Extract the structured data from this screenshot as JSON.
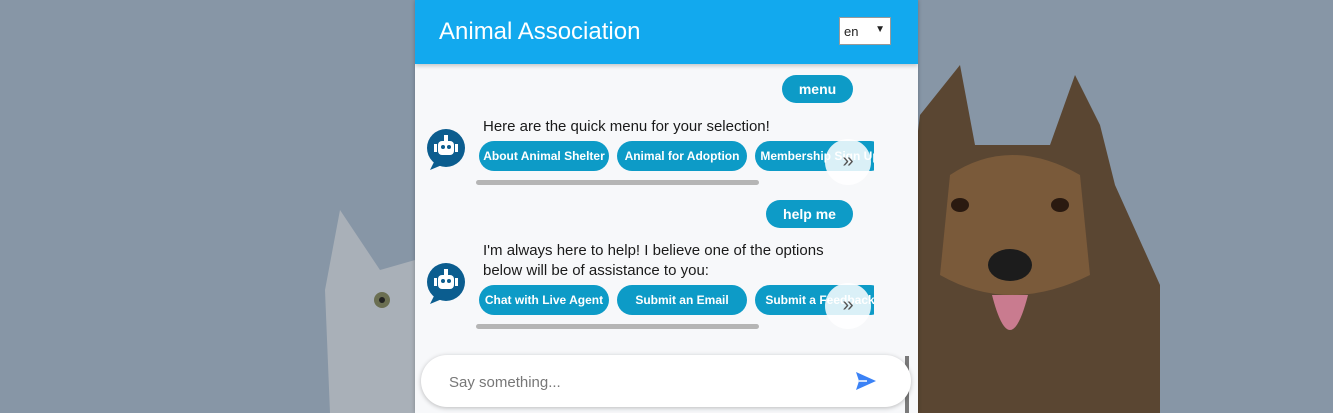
{
  "header": {
    "title": "Animal Association",
    "language": "en"
  },
  "conversation": [
    {
      "user_message": "menu",
      "bot_text": [
        "Here are the quick menu for your selection!"
      ],
      "options": [
        "About Animal Shelter",
        "Animal for Adoption",
        "Membership Sign Up"
      ]
    },
    {
      "user_message": "help me",
      "bot_text": [
        "I'm always here to help! I believe one of the options",
        "below will be of assistance to you:"
      ],
      "options": [
        "Chat with Live Agent",
        "Submit an Email",
        "Submit a Feedback"
      ]
    }
  ],
  "next_button_label": "»",
  "input": {
    "placeholder": "Say something..."
  },
  "colors": {
    "header": "#12a9ee",
    "chip": "#0d9bc7",
    "send_icon": "#3b82f6",
    "background": "#8796a6"
  },
  "icons": [
    "bot-avatar-icon",
    "send-icon",
    "dropdown-caret-icon",
    "double-chevron-right-icon"
  ]
}
